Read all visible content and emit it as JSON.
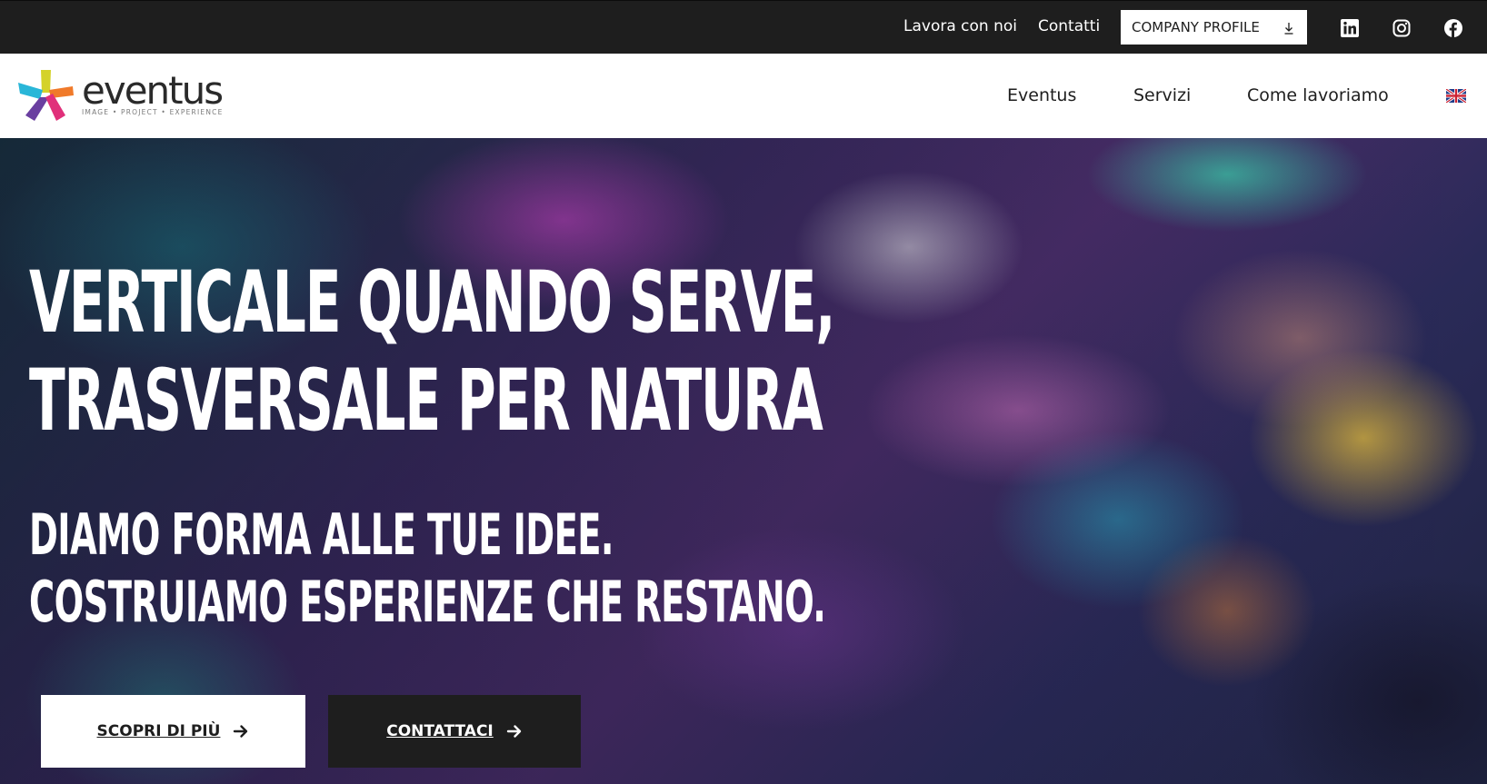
{
  "topbar": {
    "links": [
      {
        "label": "Lavora con noi"
      },
      {
        "label": "Contatti"
      }
    ],
    "company_profile": {
      "label": "COMPANY PROFILE",
      "icon": "download-icon"
    },
    "social": [
      {
        "icon": "linkedin-icon"
      },
      {
        "icon": "instagram-icon"
      },
      {
        "icon": "facebook-icon"
      }
    ]
  },
  "header": {
    "logo": {
      "name": "eventus",
      "tagline": "IMAGE • PROJECT • EXPERIENCE"
    },
    "nav": [
      {
        "label": "Eventus"
      },
      {
        "label": "Servizi"
      },
      {
        "label": "Come lavoriamo"
      }
    ],
    "language_icon": "uk-flag-icon"
  },
  "hero": {
    "headline_line1": "VERTICALE QUANDO SERVE,",
    "headline_line2": "TRASVERSALE PER NATURA",
    "subhead_line1": "DIAMO FORMA ALLE TUE IDEE.",
    "subhead_line2": "COSTRUIAMO ESPERIENZE CHE RESTANO.",
    "buttons": [
      {
        "label": "SCOPRI DI PIÙ",
        "icon": "arrow-right-icon"
      },
      {
        "label": "CONTATTACI",
        "icon": "arrow-right-icon"
      }
    ]
  },
  "colors": {
    "topbar_bg": "#1e1e1e",
    "header_bg": "#ffffff",
    "text_dark": "#1e1e1e",
    "logo_cyan": "#29b6d8",
    "logo_yellow": "#d4d22a",
    "logo_orange": "#f07a2a",
    "logo_magenta": "#e0307a",
    "logo_purple": "#6a3fa0"
  }
}
